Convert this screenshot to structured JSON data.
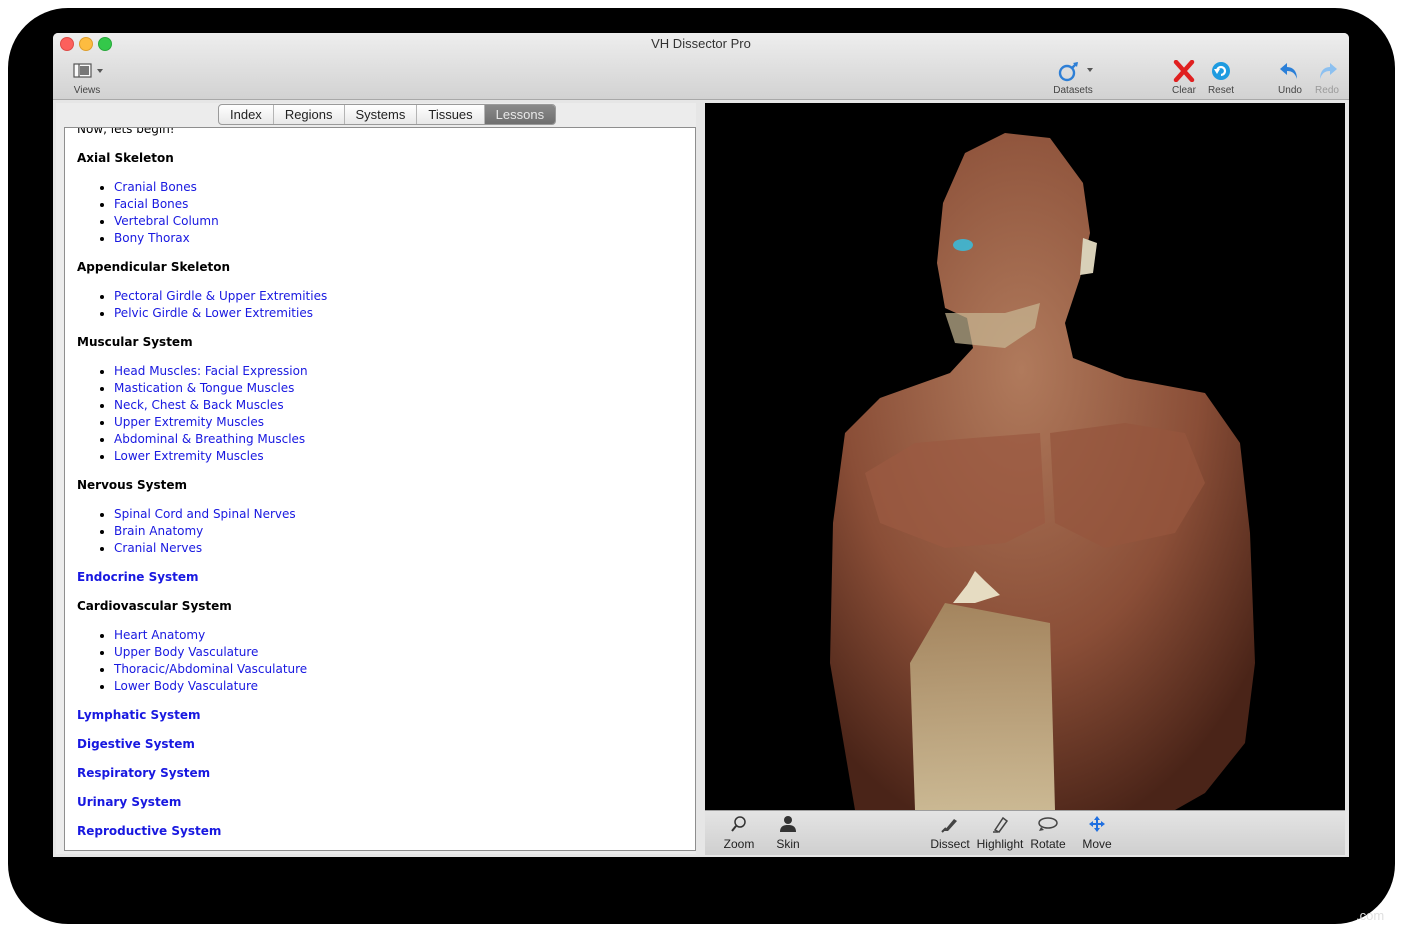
{
  "window": {
    "title": "VH Dissector Pro"
  },
  "toolbar": {
    "views": "Views",
    "datasets": "Datasets",
    "clear": "Clear",
    "reset": "Reset",
    "undo": "Undo",
    "redo": "Redo"
  },
  "tabs": [
    "Index",
    "Regions",
    "Systems",
    "Tissues",
    "Lessons"
  ],
  "active_tab": "Lessons",
  "lessons": {
    "intro": "Now, lets begin!",
    "sections": [
      {
        "title": "Axial Skeleton",
        "items": [
          "Cranial Bones",
          "Facial Bones",
          "Vertebral Column",
          "Bony Thorax"
        ]
      },
      {
        "title": "Appendicular Skeleton",
        "items": [
          "Pectoral Girdle & Upper Extremities",
          "Pelvic Girdle & Lower Extremities"
        ]
      },
      {
        "title": "Muscular System",
        "items": [
          "Head Muscles: Facial Expression",
          "Mastication & Tongue Muscles",
          "Neck, Chest & Back Muscles",
          "Upper Extremity Muscles",
          "Abdominal & Breathing Muscles",
          "Lower Extremity Muscles"
        ]
      },
      {
        "title": "Nervous System",
        "items": [
          "Spinal Cord and Spinal Nerves",
          "Brain Anatomy",
          "Cranial Nerves"
        ]
      },
      {
        "title": "Endocrine System",
        "link": true
      },
      {
        "title": "Cardiovascular System",
        "items": [
          "Heart Anatomy",
          "Upper Body Vasculature",
          "Thoracic/Abdominal Vasculature",
          "Lower Body Vasculature"
        ]
      },
      {
        "title": "Lymphatic System",
        "link": true
      },
      {
        "title": "Digestive System",
        "link": true
      },
      {
        "title": "Respiratory System",
        "link": true
      },
      {
        "title": "Urinary System",
        "link": true
      },
      {
        "title": "Reproductive System",
        "link": true
      }
    ]
  },
  "tools": {
    "zoom": "Zoom",
    "skin": "Skin",
    "dissect": "Dissect",
    "highlight": "Highlight",
    "rotate": "Rotate",
    "move": "Move"
  },
  "watermark": ".com"
}
